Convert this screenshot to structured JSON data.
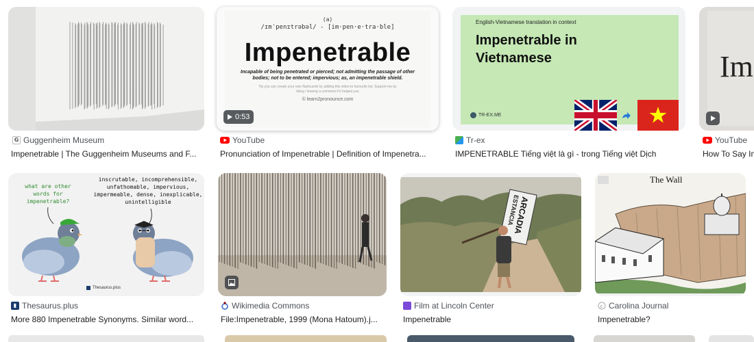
{
  "results": [
    {
      "source": "Guggenheim Museum",
      "title": "Impenetrable | The Guggenheim Museums and F..."
    },
    {
      "source": "YouTube",
      "title": "Pronunciation of Impenetrable | Definition of Impenetra...",
      "duration": "0:53",
      "thumb": {
        "phonetic": "/ɪmˈpenɪtrəbəl/ - [im·pen·e·tra·ble]",
        "phonetic_mark": "(a)",
        "word": "Impenetrable",
        "definition": "Incapable of being penetrated or pierced; not admitting the passage of other bodies; not to be entered; impervious; as, an impenetrable shield.",
        "tip": "Tip you can create your own flashcards by adding this video to favourite list. Support me by liking / leaving a comment if it helped you",
        "credit": "© learn2pronounce.com"
      }
    },
    {
      "source": "Tr-ex",
      "title": "IMPENETRABLE Tiếng việt là gì - trong Tiếng việt Dịch",
      "thumb": {
        "header": "English-Vietnamese translation in context",
        "line1": "Impenetrable in",
        "line2": "Vietnamese",
        "logo": "TR-EX.ME"
      }
    },
    {
      "source": "YouTube",
      "title": "How To Say Im",
      "thumb": {
        "word": "Im"
      }
    },
    {
      "source": "Thesaurus.plus",
      "title": "More 880 Impenetrable Synonyms. Similar word...",
      "thumb": {
        "question": "what are other words for impenetrable?",
        "answer": "inscrutable, incomprehensible, unfathomable, impervious, impermeable, dense, inexplicable, unintelligible",
        "brand": "Thesaurus.plus"
      }
    },
    {
      "source": "Wikimedia Commons",
      "title": "File:Impenetrable, 1999 (Mona Hatoum).j..."
    },
    {
      "source": "Film at Lincoln Center",
      "title": "Impenetrable",
      "thumb": {
        "sign_line1": "ESTANCIA",
        "sign_line2": "ARCADIA"
      }
    },
    {
      "source": "Carolina Journal",
      "title": "Impenetrable?",
      "thumb": {
        "caption": "The Wall"
      }
    }
  ]
}
